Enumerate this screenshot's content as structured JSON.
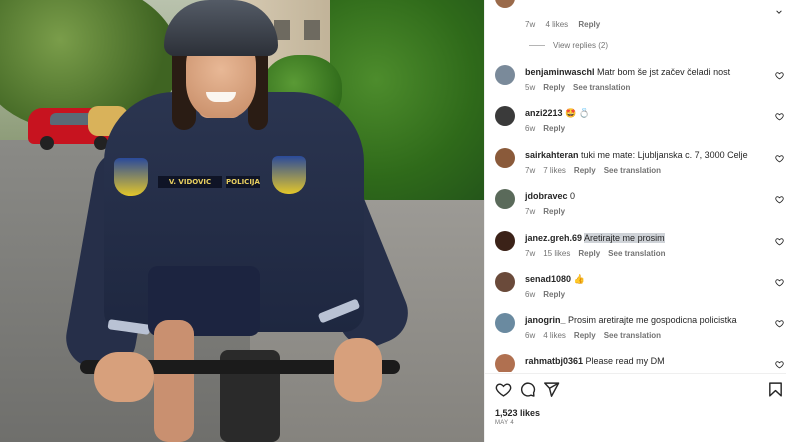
{
  "post": {
    "photo_alt": "post-photo",
    "name_tag_left": "V. VIDOVIC",
    "name_tag_right": "POLICIJA",
    "badge_text": "POLICIJA"
  },
  "comments_top": {
    "first": {
      "time": "7w",
      "likes": "4 likes",
      "reply": "Reply"
    },
    "view_replies": "View replies (2)"
  },
  "comments": [
    {
      "user": "benjaminwaschl",
      "text": "Matr bom še jst začev čeladi nost",
      "time": "5w",
      "likes": "",
      "reply": "Reply",
      "translate": "See translation",
      "avatar_color": "#7a8a9a"
    },
    {
      "user": "anzi2213",
      "text": "🤩 💍",
      "time": "6w",
      "likes": "",
      "reply": "Reply",
      "translate": "",
      "avatar_color": "#3a3a3a"
    },
    {
      "user": "sairkahteran",
      "text": "tuki me mate: Ljubljanska c. 7, 3000 Celje",
      "time": "7w",
      "likes": "7 likes",
      "reply": "Reply",
      "translate": "See translation",
      "avatar_color": "#8a5a3a"
    },
    {
      "user": "jdobravec",
      "text": "0",
      "time": "7w",
      "likes": "",
      "reply": "Reply",
      "translate": "",
      "avatar_color": "#5a6a5a"
    },
    {
      "user": "janez.greh.69",
      "text": "Aretirajte me prosim",
      "time": "7w",
      "likes": "15 likes",
      "reply": "Reply",
      "translate": "See translation",
      "avatar_color": "#3b2218"
    },
    {
      "user": "senad1080",
      "text": "👍",
      "time": "6w",
      "likes": "",
      "reply": "Reply",
      "translate": "",
      "avatar_color": "#6a4a3a"
    },
    {
      "user": "janogrin_",
      "text": "Prosim aretirajte me gospodicna policistka",
      "time": "6w",
      "likes": "4 likes",
      "reply": "Reply",
      "translate": "See translation",
      "avatar_color": "#6a8aa0"
    },
    {
      "user": "rahmatbj0361",
      "text": "Please read my DM",
      "time": "",
      "likes": "",
      "reply": "",
      "translate": "",
      "avatar_color": "#b07050"
    }
  ],
  "footer": {
    "likes": "1,523 likes",
    "date": "MAY 4"
  },
  "icons": {
    "like": "heart-icon",
    "comment": "comment-icon",
    "share": "send-icon",
    "save": "bookmark-icon"
  }
}
